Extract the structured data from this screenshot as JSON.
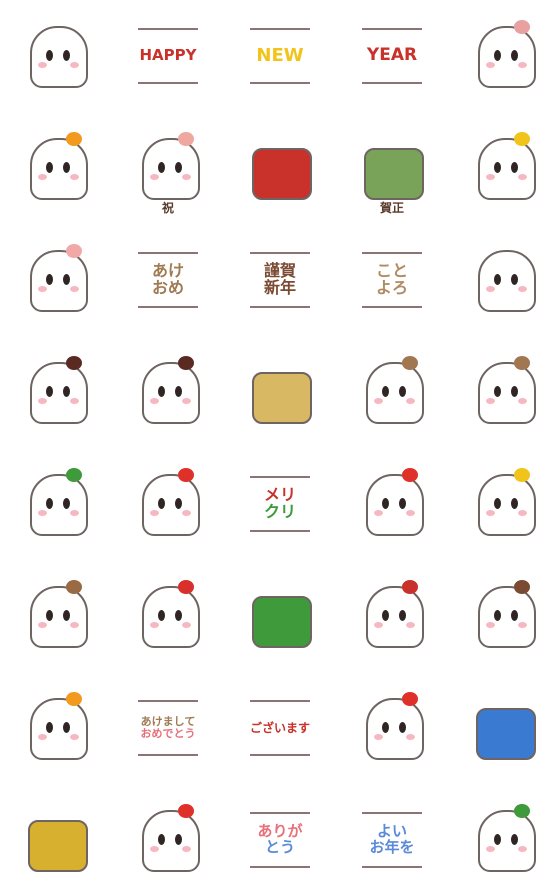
{
  "cells": [
    {
      "kind": "ghost",
      "name": "ghost-peeking-left"
    },
    {
      "kind": "card",
      "name": "happy-card",
      "lines": [
        "HAPPY"
      ],
      "color": "#c8322a",
      "size": 15
    },
    {
      "kind": "card",
      "name": "new-card",
      "lines": [
        "NEW"
      ],
      "color": "#f2c419",
      "size": 18
    },
    {
      "kind": "card",
      "name": "year-card",
      "lines": [
        "YEAR"
      ],
      "color": "#c8322a",
      "size": 17
    },
    {
      "kind": "ghost",
      "name": "ghost-peeking-right",
      "accent": "#e8a0a0"
    },
    {
      "kind": "ghost",
      "name": "ghost-kagami-mochi",
      "accent": "#f39a1e"
    },
    {
      "kind": "ghost",
      "name": "ghost-couple-celebration",
      "accent": "#f0a7a0",
      "label": "祝"
    },
    {
      "kind": "object",
      "name": "daruma",
      "accent": "#c8322a"
    },
    {
      "kind": "object",
      "name": "kadomatsu-ghost",
      "accent": "#7aa35a",
      "label": "賀正"
    },
    {
      "kind": "ghost",
      "name": "lucky-cat-ghost",
      "accent": "#f2c419"
    },
    {
      "kind": "ghost",
      "name": "pink-ghost-peeking",
      "accent": "#f3a8a8"
    },
    {
      "kind": "card",
      "name": "akeome-card",
      "lines": [
        "あけ",
        "おめ"
      ],
      "color": "#a07a52",
      "size": 16
    },
    {
      "kind": "card",
      "name": "kinga-shinnen-card",
      "lines": [
        "謹賀",
        "新年"
      ],
      "color": "#7b4a32",
      "size": 16
    },
    {
      "kind": "card",
      "name": "kotoyoro-card",
      "lines": [
        "こと",
        "よろ"
      ],
      "color": "#b08a62",
      "size": 16
    },
    {
      "kind": "ghost",
      "name": "ghost-peeking-bottom"
    },
    {
      "kind": "ghost",
      "name": "ghost-in-bowl",
      "accent": "#5a2a22"
    },
    {
      "kind": "ghost",
      "name": "ghost-in-bowl-eyes-closed",
      "accent": "#5a2a22"
    },
    {
      "kind": "object",
      "name": "lucky-bag",
      "accent": "#d8b862"
    },
    {
      "kind": "ghost",
      "name": "ghost-mochi-pounding",
      "accent": "#a27650"
    },
    {
      "kind": "ghost",
      "name": "mochi-mortar",
      "accent": "#a27650"
    },
    {
      "kind": "ghost",
      "name": "snow-rabbit-ghost",
      "accent": "#3f9a3c"
    },
    {
      "kind": "ghost",
      "name": "ghost-with-heart",
      "accent": "#e0302a"
    },
    {
      "kind": "card",
      "name": "merikuri-card",
      "lines": [
        "メリ",
        "クリ"
      ],
      "color": "#c8322a",
      "color2": "#3f9a3c",
      "size": 16
    },
    {
      "kind": "ghost",
      "name": "ghost-with-flag",
      "accent": "#e0302a"
    },
    {
      "kind": "ghost",
      "name": "angel-ghost-trumpet",
      "accent": "#f2c419"
    },
    {
      "kind": "ghost",
      "name": "reindeer-ghost",
      "accent": "#9a6a44"
    },
    {
      "kind": "ghost",
      "name": "santa-ghost",
      "accent": "#d8302a"
    },
    {
      "kind": "object",
      "name": "christmas-tree",
      "accent": "#3f9a3c"
    },
    {
      "kind": "ghost",
      "name": "snowman-ghost",
      "accent": "#c8322a"
    },
    {
      "kind": "ghost",
      "name": "ghost-with-chopsticks",
      "accent": "#7a4a32"
    },
    {
      "kind": "ghost",
      "name": "ghost-with-mikan",
      "accent": "#f39a1e"
    },
    {
      "kind": "card",
      "name": "akemashite-omedetou-card",
      "lines": [
        "あけまして",
        "おめでとう"
      ],
      "color": "#a07a52",
      "color2": "#e8707a",
      "size": 11
    },
    {
      "kind": "card",
      "name": "gozaimasu-card",
      "lines": [
        "ございます"
      ],
      "color": "#c8322a",
      "size": 12
    },
    {
      "kind": "ghost",
      "name": "ghosts-with-flags",
      "accent": "#e0302a"
    },
    {
      "kind": "object",
      "name": "mount-fuji-ghost",
      "accent": "#3a7ad0"
    },
    {
      "kind": "object",
      "name": "yellow-bird",
      "accent": "#d8b030"
    },
    {
      "kind": "ghost",
      "name": "ghosts-waving-flags",
      "accent": "#e0302a"
    },
    {
      "kind": "card",
      "name": "arigatou-card",
      "lines": [
        "ありが",
        "とう"
      ],
      "color": "#e8707a",
      "color2": "#5a8ad8",
      "size": 15
    },
    {
      "kind": "card",
      "name": "yoi-otoshiwo-card",
      "lines": [
        "よい",
        "お年を"
      ],
      "color": "#5a8ad8",
      "size": 15
    },
    {
      "kind": "ghost",
      "name": "ghost-with-stars",
      "accent": "#3f9a3c"
    }
  ]
}
